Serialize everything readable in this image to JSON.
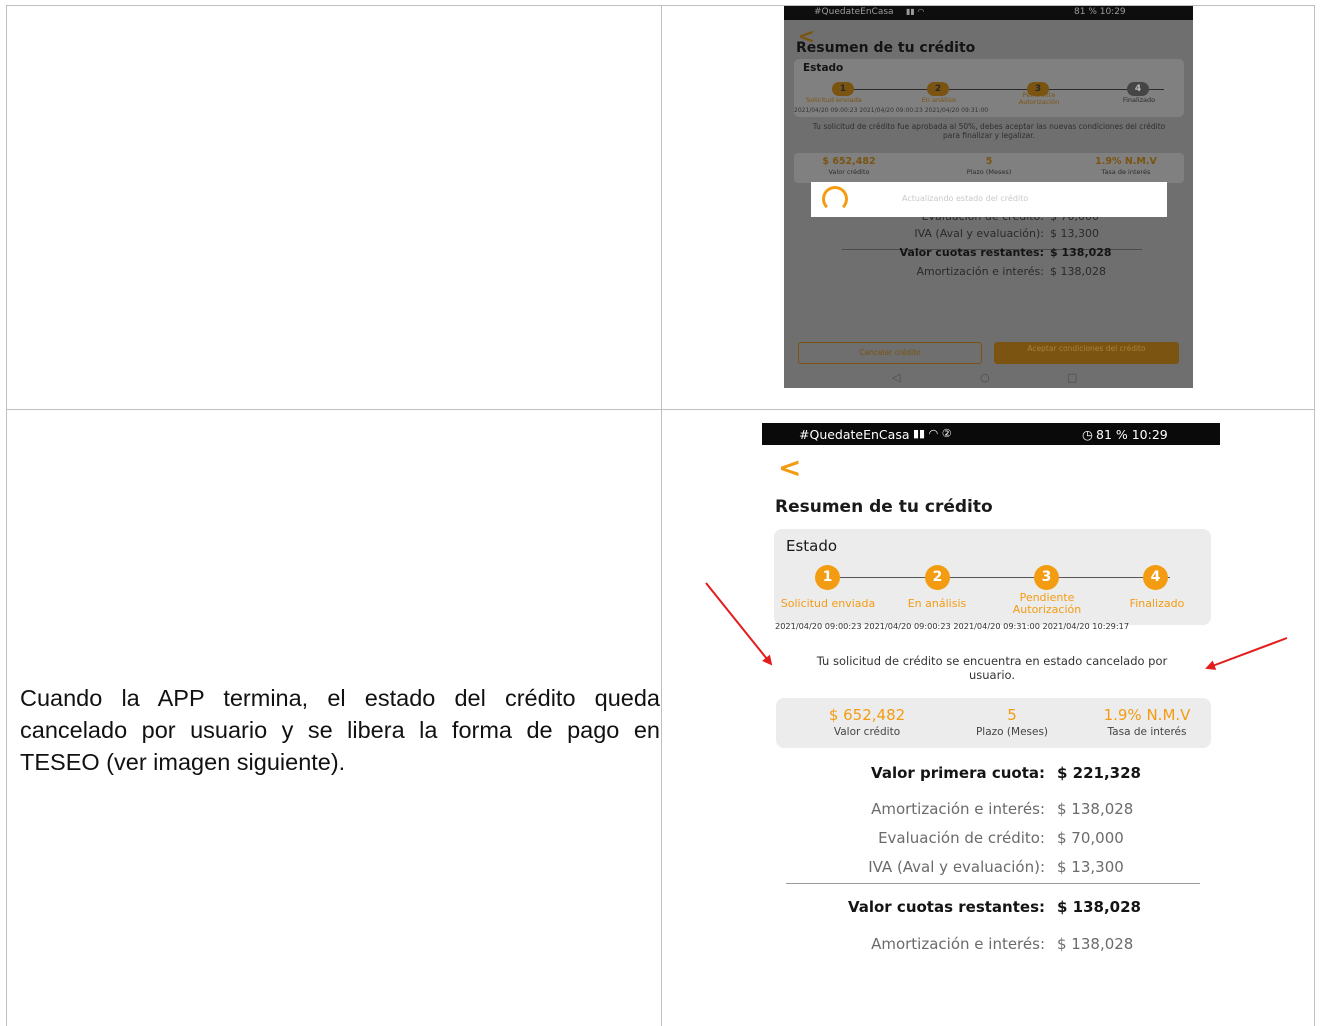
{
  "document": {
    "paragraph": "Cuando la APP termina, el estado del crédito queda cancelado por usuario y se libera la forma de pago en TESEO (ver imagen siguiente)."
  },
  "screenshot_1": {
    "status_bar": {
      "left": "#QuedateEnCasa",
      "right": "81 % 10:29"
    },
    "title": "Resumen de tu crédito",
    "estado_label": "Estado",
    "steps": [
      {
        "num": "1",
        "label": "Solicitud enviada"
      },
      {
        "num": "2",
        "label": "En análisis"
      },
      {
        "num": "3",
        "label": "Pendiente Autorización"
      },
      {
        "num": "4",
        "label": "Finalizado"
      }
    ],
    "dates": "2021/04/20 09:00:23 2021/04/20 09:00:23 2021/04/20 09:31:00",
    "message": "Tu solicitud de crédito fue aprobada al 50%, debes aceptar las nuevas condiciones del crédito para finalizar y legalizar.",
    "summary": [
      {
        "value": "$ 652,482",
        "label": "Valor crédito"
      },
      {
        "value": "5",
        "label": "Plazo (Meses)"
      },
      {
        "value": "1.9% N.M.V",
        "label": "Tasa de interés"
      }
    ],
    "dialog_text": "Actualizando estado del crédito",
    "rows": [
      {
        "label": "Evaluación de crédito:",
        "value": "$ 70,000"
      },
      {
        "label": "IVA (Aval y evaluación):",
        "value": "$ 13,300"
      },
      {
        "label": "Valor cuotas restantes:",
        "value": "$ 138,028"
      },
      {
        "label": "Amortización e interés:",
        "value": "$ 138,028"
      }
    ],
    "buttons": {
      "cancel": "Cancelar crédito",
      "accept": "Aceptar condiciones del crédito"
    }
  },
  "screenshot_2": {
    "status_bar": {
      "left": "#QuedateEnCasa",
      "right": "81 % 10:29"
    },
    "title": "Resumen de tu crédito",
    "estado_label": "Estado",
    "steps": [
      {
        "num": "1",
        "label": "Solicitud enviada"
      },
      {
        "num": "2",
        "label": "En análisis"
      },
      {
        "num": "3",
        "label": "Pendiente Autorización"
      },
      {
        "num": "4",
        "label": "Finalizado"
      }
    ],
    "dates": "2021/04/20 09:00:23 2021/04/20 09:00:23 2021/04/20 09:31:00 2021/04/20 10:29:17",
    "message": "Tu solicitud de crédito se encuentra en estado cancelado por usuario.",
    "summary": [
      {
        "value": "$ 652,482",
        "label": "Valor crédito"
      },
      {
        "value": "5",
        "label": "Plazo (Meses)"
      },
      {
        "value": "1.9% N.M.V",
        "label": "Tasa de interés"
      }
    ],
    "rows": [
      {
        "label": "Valor primera cuota:",
        "value": "$ 221,328"
      },
      {
        "label": "Amortización e interés:",
        "value": "$ 138,028"
      },
      {
        "label": "Evaluación de crédito:",
        "value": "$ 70,000"
      },
      {
        "label": "IVA (Aval y evaluación):",
        "value": "$ 13,300"
      },
      {
        "label": "Valor cuotas restantes:",
        "value": "$ 138,028"
      },
      {
        "label": "Amortización e interés:",
        "value": "$ 138,028"
      }
    ]
  },
  "colors": {
    "accent": "#f39c12",
    "arrow": "#e31c1c",
    "border": "#bfbfbf"
  },
  "icons": [
    "back-chevron-icon",
    "signal-icon",
    "wifi-icon",
    "alarm-icon",
    "battery-icon",
    "nav-back-icon",
    "nav-home-icon",
    "nav-recents-icon",
    "loading-spinner-icon",
    "red-arrow-icon"
  ]
}
